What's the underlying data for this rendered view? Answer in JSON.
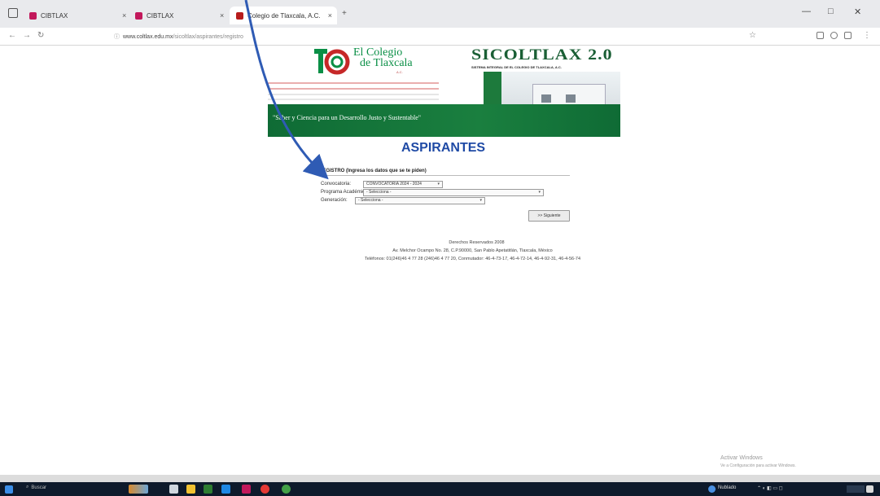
{
  "browser": {
    "tabs": [
      {
        "label": "CIBTLAX",
        "active": false
      },
      {
        "label": "CIBTLAX",
        "active": false
      },
      {
        "label": "Colegio de Tlaxcala, A.C.",
        "active": true
      }
    ],
    "url_host": "www.coltlax.edu.mx",
    "url_path": "/sicoltlax/aspirantes/registro"
  },
  "banner": {
    "logo_line1": "El Colegio",
    "logo_line2": "de Tlaxcala",
    "logo_suffix": "A.C.",
    "system_name": "SICOLTLAX 2.0",
    "system_desc": "SISTEMA INTEGRAL DE EL COLEGIO DE TLAXCALA, A.C.",
    "slogan": "\"Saber y Ciencia para un Desarrollo Justo y Sustentable\""
  },
  "page": {
    "heading": "ASPIRANTES",
    "form_title": "REGISTRO (Ingresa los datos que se te piden)",
    "fields": [
      {
        "label": "Convocatoria:",
        "value": "CONVOCATORIA 2024 - 2024"
      },
      {
        "label": "Programa Académico:",
        "value": "- Selecciona -"
      },
      {
        "label": "Generación:",
        "value": "- Selecciona -"
      }
    ],
    "next_button": ">> Siguiente"
  },
  "footer": {
    "line1": "Derechos Reservados 2008",
    "line2": "Av. Melchor Ocampo No. 28, C.P.90000, San Pablo Apetatitlán, Tlaxcala, México",
    "line3": "Teléfonos: 01(246)46 4 77 28 (246)46 4 77 20, Conmutador: 46-4-73-17, 46-4-72-14, 46-4-92-31, 46-4-56-74"
  },
  "watermark": {
    "title": "Activar Windows",
    "subtitle": "Ve a Configuración para activar Windows."
  },
  "taskbar": {
    "search": "Buscar",
    "weather": "Nublado"
  },
  "colors": {
    "brand_green": "#0f6b35",
    "heading_blue": "#1f4aa5",
    "annotation_arrow": "#2f5bb4"
  }
}
